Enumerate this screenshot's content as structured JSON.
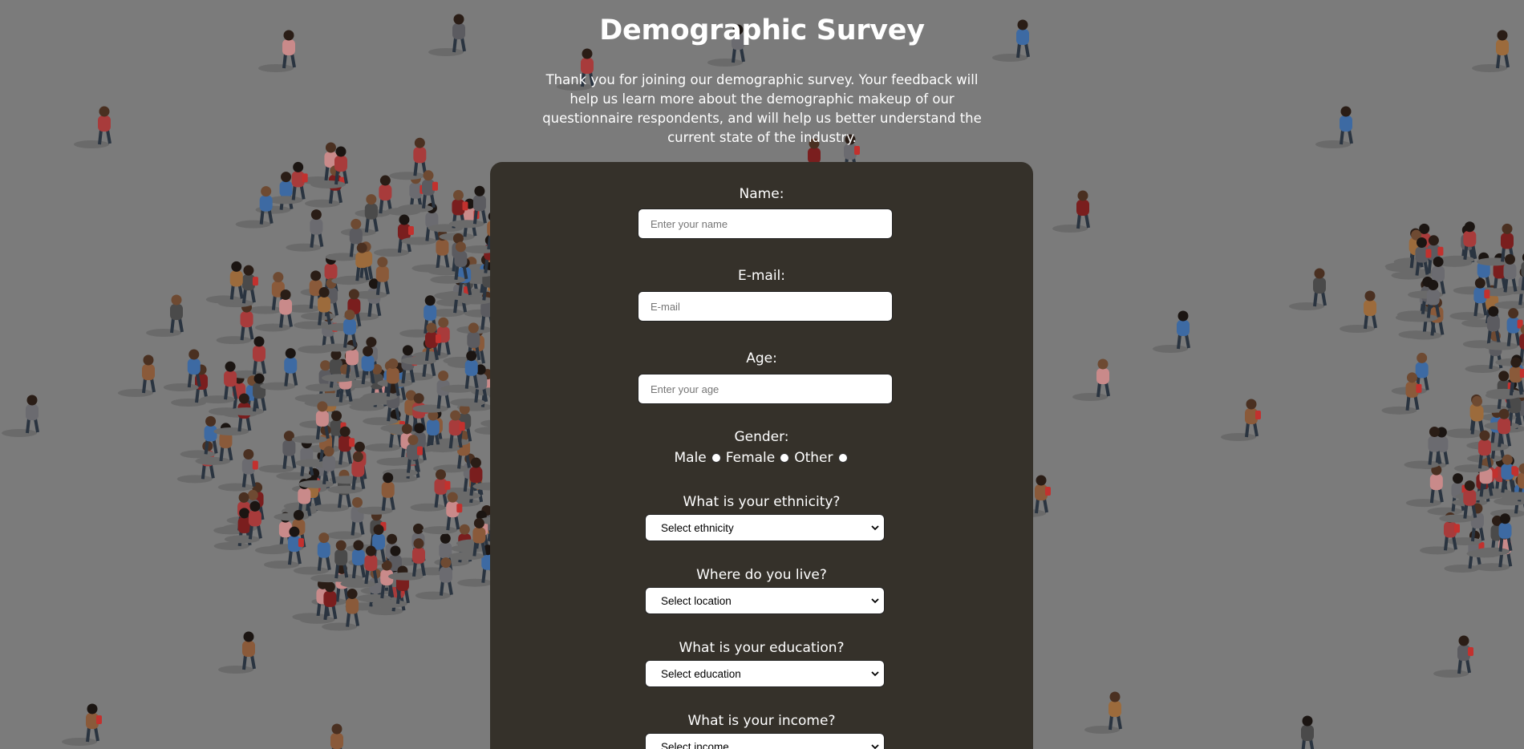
{
  "header": {
    "title": "Demographic Survey",
    "intro": "Thank you for joining our demographic survey. Your feedback will help us learn more about the demographic makeup of our questionnaire respondents, and will help us better understand the current state of the industry."
  },
  "form": {
    "name": {
      "label": "Name:",
      "placeholder": "Enter your name"
    },
    "email": {
      "label": "E-mail:",
      "placeholder": "E-mail"
    },
    "age": {
      "label": "Age:",
      "placeholder": "Enter your age"
    },
    "gender": {
      "label": "Gender:",
      "options": [
        "Male",
        "Female",
        "Other"
      ]
    },
    "ethnicity": {
      "label": "What is your ethnicity?",
      "selected": "Select ethnicity"
    },
    "location": {
      "label": "Where do you live?",
      "selected": "Select location"
    },
    "education": {
      "label": "What is your education?",
      "selected": "Select education"
    },
    "income": {
      "label": "What is your income?",
      "selected": "Select income"
    }
  },
  "colors": {
    "background": "#7b7b7b",
    "card": "#35312a",
    "text": "#ffffff"
  },
  "icons": {
    "select_arrow": "chevron-down-icon"
  }
}
